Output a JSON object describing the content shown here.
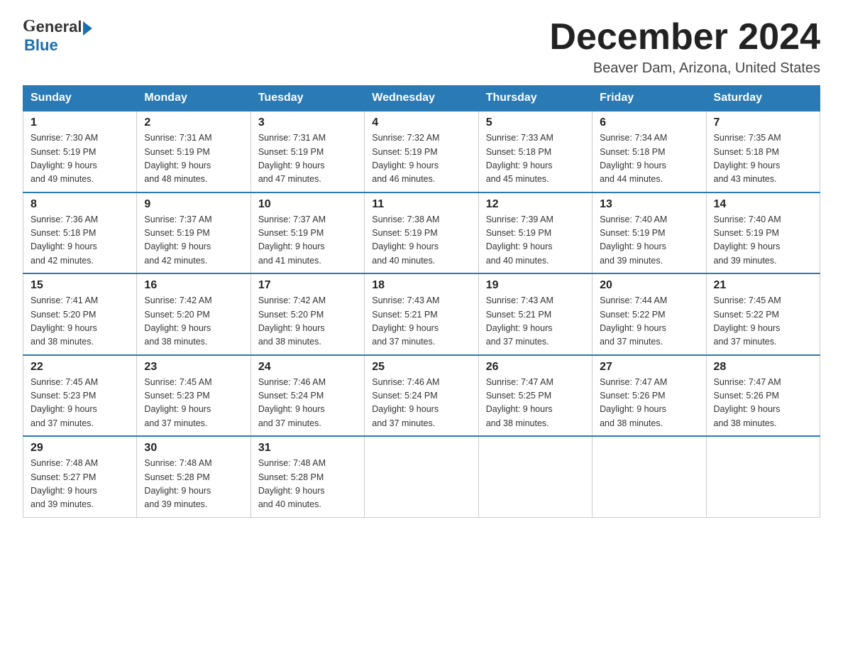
{
  "header": {
    "logo_general": "General",
    "logo_blue": "Blue",
    "month_title": "December 2024",
    "location": "Beaver Dam, Arizona, United States"
  },
  "days_of_week": [
    "Sunday",
    "Monday",
    "Tuesday",
    "Wednesday",
    "Thursday",
    "Friday",
    "Saturday"
  ],
  "weeks": [
    [
      {
        "day": "1",
        "sunrise": "7:30 AM",
        "sunset": "5:19 PM",
        "daylight": "9 hours and 49 minutes."
      },
      {
        "day": "2",
        "sunrise": "7:31 AM",
        "sunset": "5:19 PM",
        "daylight": "9 hours and 48 minutes."
      },
      {
        "day": "3",
        "sunrise": "7:31 AM",
        "sunset": "5:19 PM",
        "daylight": "9 hours and 47 minutes."
      },
      {
        "day": "4",
        "sunrise": "7:32 AM",
        "sunset": "5:19 PM",
        "daylight": "9 hours and 46 minutes."
      },
      {
        "day": "5",
        "sunrise": "7:33 AM",
        "sunset": "5:18 PM",
        "daylight": "9 hours and 45 minutes."
      },
      {
        "day": "6",
        "sunrise": "7:34 AM",
        "sunset": "5:18 PM",
        "daylight": "9 hours and 44 minutes."
      },
      {
        "day": "7",
        "sunrise": "7:35 AM",
        "sunset": "5:18 PM",
        "daylight": "9 hours and 43 minutes."
      }
    ],
    [
      {
        "day": "8",
        "sunrise": "7:36 AM",
        "sunset": "5:18 PM",
        "daylight": "9 hours and 42 minutes."
      },
      {
        "day": "9",
        "sunrise": "7:37 AM",
        "sunset": "5:19 PM",
        "daylight": "9 hours and 42 minutes."
      },
      {
        "day": "10",
        "sunrise": "7:37 AM",
        "sunset": "5:19 PM",
        "daylight": "9 hours and 41 minutes."
      },
      {
        "day": "11",
        "sunrise": "7:38 AM",
        "sunset": "5:19 PM",
        "daylight": "9 hours and 40 minutes."
      },
      {
        "day": "12",
        "sunrise": "7:39 AM",
        "sunset": "5:19 PM",
        "daylight": "9 hours and 40 minutes."
      },
      {
        "day": "13",
        "sunrise": "7:40 AM",
        "sunset": "5:19 PM",
        "daylight": "9 hours and 39 minutes."
      },
      {
        "day": "14",
        "sunrise": "7:40 AM",
        "sunset": "5:19 PM",
        "daylight": "9 hours and 39 minutes."
      }
    ],
    [
      {
        "day": "15",
        "sunrise": "7:41 AM",
        "sunset": "5:20 PM",
        "daylight": "9 hours and 38 minutes."
      },
      {
        "day": "16",
        "sunrise": "7:42 AM",
        "sunset": "5:20 PM",
        "daylight": "9 hours and 38 minutes."
      },
      {
        "day": "17",
        "sunrise": "7:42 AM",
        "sunset": "5:20 PM",
        "daylight": "9 hours and 38 minutes."
      },
      {
        "day": "18",
        "sunrise": "7:43 AM",
        "sunset": "5:21 PM",
        "daylight": "9 hours and 37 minutes."
      },
      {
        "day": "19",
        "sunrise": "7:43 AM",
        "sunset": "5:21 PM",
        "daylight": "9 hours and 37 minutes."
      },
      {
        "day": "20",
        "sunrise": "7:44 AM",
        "sunset": "5:22 PM",
        "daylight": "9 hours and 37 minutes."
      },
      {
        "day": "21",
        "sunrise": "7:45 AM",
        "sunset": "5:22 PM",
        "daylight": "9 hours and 37 minutes."
      }
    ],
    [
      {
        "day": "22",
        "sunrise": "7:45 AM",
        "sunset": "5:23 PM",
        "daylight": "9 hours and 37 minutes."
      },
      {
        "day": "23",
        "sunrise": "7:45 AM",
        "sunset": "5:23 PM",
        "daylight": "9 hours and 37 minutes."
      },
      {
        "day": "24",
        "sunrise": "7:46 AM",
        "sunset": "5:24 PM",
        "daylight": "9 hours and 37 minutes."
      },
      {
        "day": "25",
        "sunrise": "7:46 AM",
        "sunset": "5:24 PM",
        "daylight": "9 hours and 37 minutes."
      },
      {
        "day": "26",
        "sunrise": "7:47 AM",
        "sunset": "5:25 PM",
        "daylight": "9 hours and 38 minutes."
      },
      {
        "day": "27",
        "sunrise": "7:47 AM",
        "sunset": "5:26 PM",
        "daylight": "9 hours and 38 minutes."
      },
      {
        "day": "28",
        "sunrise": "7:47 AM",
        "sunset": "5:26 PM",
        "daylight": "9 hours and 38 minutes."
      }
    ],
    [
      {
        "day": "29",
        "sunrise": "7:48 AM",
        "sunset": "5:27 PM",
        "daylight": "9 hours and 39 minutes."
      },
      {
        "day": "30",
        "sunrise": "7:48 AM",
        "sunset": "5:28 PM",
        "daylight": "9 hours and 39 minutes."
      },
      {
        "day": "31",
        "sunrise": "7:48 AM",
        "sunset": "5:28 PM",
        "daylight": "9 hours and 40 minutes."
      },
      null,
      null,
      null,
      null
    ]
  ],
  "labels": {
    "sunrise": "Sunrise:",
    "sunset": "Sunset:",
    "daylight": "Daylight:"
  }
}
